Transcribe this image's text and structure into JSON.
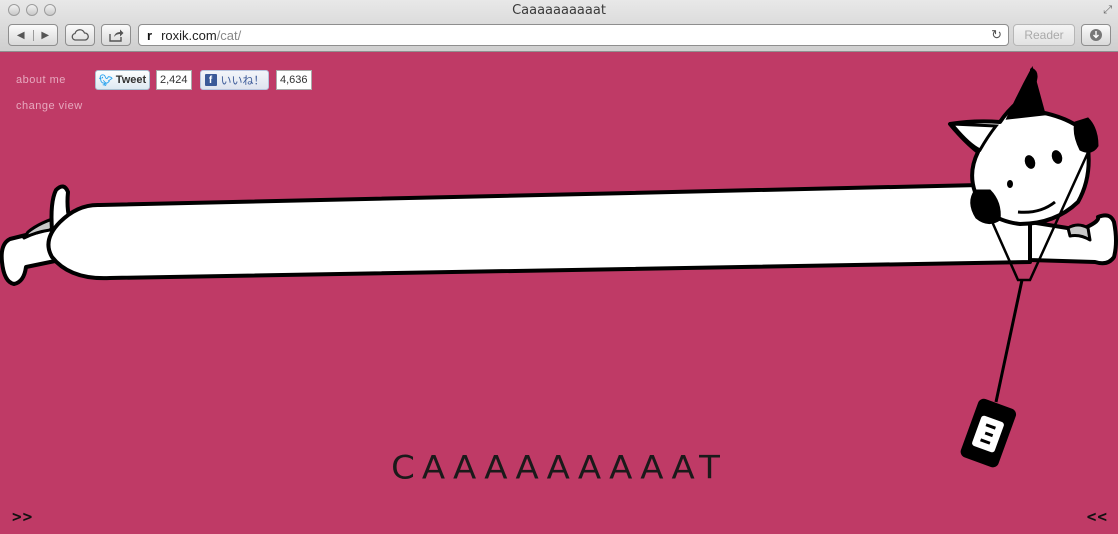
{
  "window": {
    "title": "Caaaaaaaaaat"
  },
  "toolbar": {
    "back_icon": "back-arrow-icon",
    "forward_icon": "forward-arrow-icon",
    "url_host": "roxik.com",
    "url_path": "/cat/",
    "reader_label": "Reader"
  },
  "page": {
    "background_color": "#bf3a66",
    "links": {
      "about": "about me",
      "change_view": "change view"
    },
    "social": {
      "tweet_label": "Tweet",
      "tweet_count": "2,424",
      "like_label": "いいね！",
      "like_count": "4,636"
    },
    "title": "CAAAAAAAAAT",
    "nav_next": ">>",
    "nav_prev": "<<"
  }
}
